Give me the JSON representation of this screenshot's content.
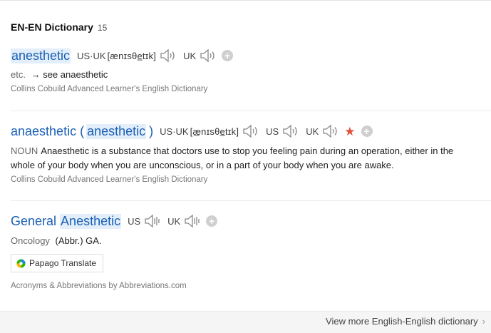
{
  "section": {
    "title": "EN-EN Dictionary",
    "count": "15"
  },
  "entries": [
    {
      "word": "anesthetic",
      "pron_label": "US·UK",
      "pron": "[ænɪsθe̲tɪk]",
      "uk_label": "UK",
      "pos": "etc.",
      "def": "→ see anaesthetic",
      "source": "Collins Cobuild Advanced Learner's English Dictionary"
    },
    {
      "word_main": "anaesthetic",
      "paren_open": "(",
      "word_alt": "anesthetic",
      "paren_close": ")",
      "pron_label": "US·UK",
      "pron": "[æ̲nɪsθe̲tɪk]",
      "us_label": "US",
      "uk_label": "UK",
      "pos": "NOUN",
      "def_line1": "Anaesthetic is a substance that doctors use to stop you feeling pain during an operation, either in the",
      "def_line2": "whole of your body when you are unconscious, or in a part of your body when you are awake.",
      "source": "Collins Cobuild Advanced Learner's English Dictionary"
    },
    {
      "word_first": "General",
      "word_second": "Anesthetic",
      "us_label": "US",
      "uk_label": "UK",
      "pos": "Oncology",
      "def": "(Abbr.) GA.",
      "translate_label": "Papago Translate",
      "source": "Acronyms & Abbreviations by Abbreviations.com"
    }
  ],
  "footer": {
    "more_label": "View more English-English dictionary",
    "chevron": "›"
  },
  "icons": {
    "speaker": "speaker-icon",
    "add": "plus-circle-icon",
    "star": "star-icon",
    "papago": "papago-logo-icon"
  },
  "colors": {
    "link": "#1a5fb4",
    "highlight": "#e2eefa",
    "star": "#e0503b"
  }
}
